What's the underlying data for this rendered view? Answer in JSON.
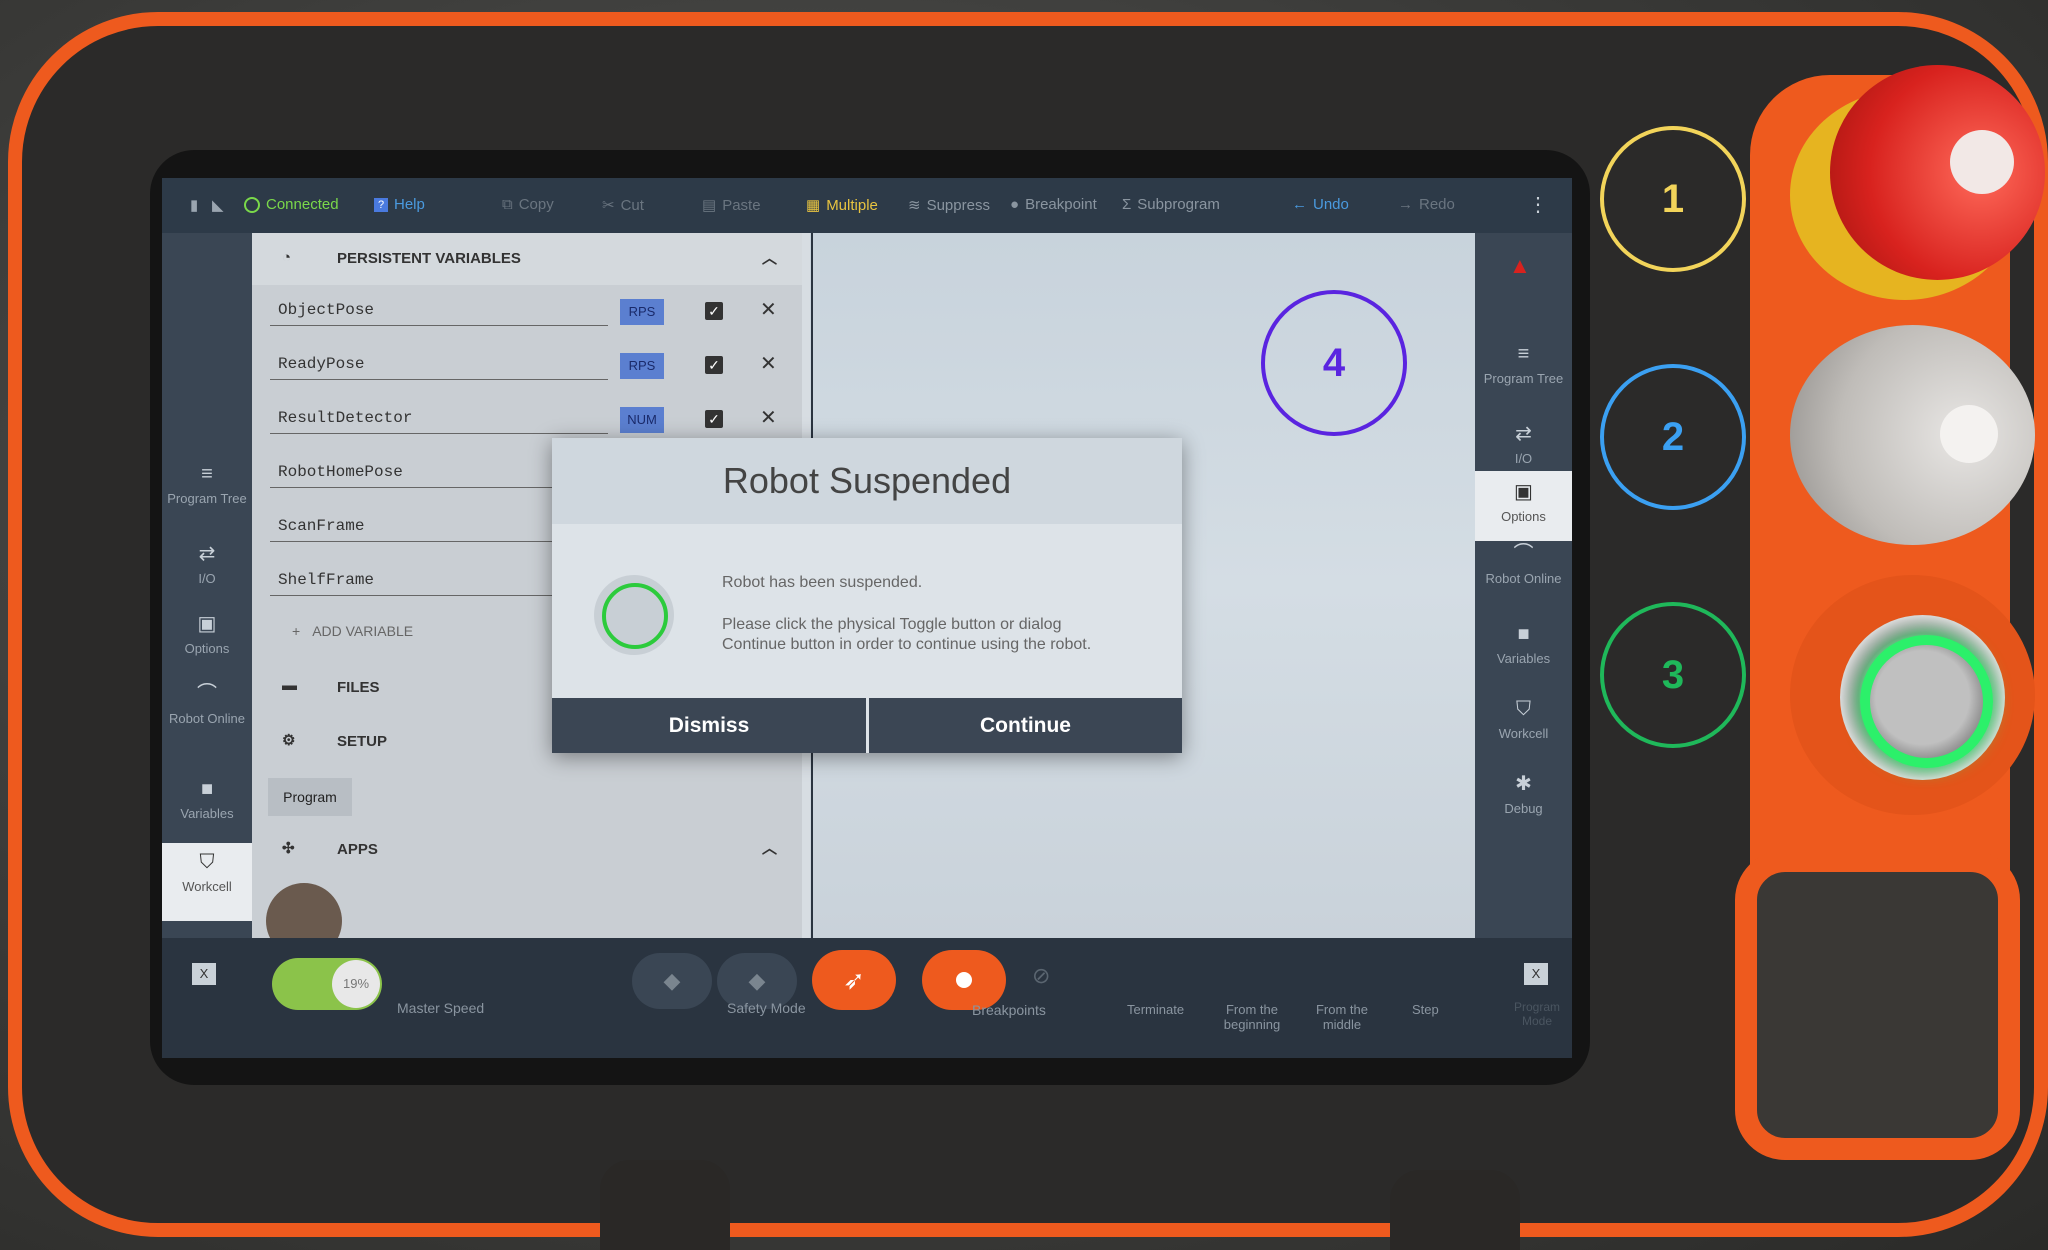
{
  "topbar": {
    "connected": "Connected",
    "help": "Help",
    "copy": "Copy",
    "cut": "Cut",
    "paste": "Paste",
    "multiple": "Multiple",
    "suppress": "Suppress",
    "breakpoint": "Breakpoint",
    "subprogram": "Subprogram",
    "undo": "Undo",
    "redo": "Redo"
  },
  "leftnav": [
    {
      "label": "Program Tree"
    },
    {
      "label": "I/O"
    },
    {
      "label": "Options"
    },
    {
      "label": "Robot Online"
    },
    {
      "label": "Variables"
    },
    {
      "label": "Workcell"
    }
  ],
  "rightnav": [
    {
      "label": "Program Tree"
    },
    {
      "label": "I/O"
    },
    {
      "label": "Options"
    },
    {
      "label": "Robot Online"
    },
    {
      "label": "Variables"
    },
    {
      "label": "Workcell"
    },
    {
      "label": "Debug"
    }
  ],
  "panel": {
    "persistent_header": "PERSISTENT VARIABLES",
    "variables": [
      {
        "name": "ObjectPose",
        "type": "RPS"
      },
      {
        "name": "ReadyPose",
        "type": "RPS"
      },
      {
        "name": "ResultDetector",
        "type": "NUM"
      },
      {
        "name": "RobotHomePose",
        "type": ""
      },
      {
        "name": "ScanFrame",
        "type": ""
      },
      {
        "name": "ShelfFrame",
        "type": ""
      }
    ],
    "add_variable": "ADD VARIABLE",
    "files": "FILES",
    "setup": "SETUP",
    "program": "Program",
    "apps": "APPS"
  },
  "dialog": {
    "title": "Robot Suspended",
    "line1": "Robot has been suspended.",
    "line2": "Please click the physical Toggle button or dialog",
    "line3": "Continue button in order to continue using the robot.",
    "dismiss": "Dismiss",
    "continue": "Continue"
  },
  "bottombar": {
    "speed_value": "19%",
    "master_speed": "Master Speed",
    "safety_mode": "Safety Mode",
    "breakpoints": "Breakpoints",
    "terminate": "Terminate",
    "from_beginning": "From the beginning",
    "from_middle": "From the middle",
    "step": "Step",
    "program_mode": "Program Mode"
  },
  "annotations": [
    "1",
    "2",
    "3",
    "4"
  ],
  "colors": {
    "annotation_1": "#f2d45a",
    "annotation_2": "#3ba0f2",
    "annotation_3": "#1fb85a",
    "annotation_4": "#5a24e0",
    "device_orange": "#ee5a1e",
    "estop_red": "#d8221e",
    "ring_green": "#2cf06a"
  }
}
